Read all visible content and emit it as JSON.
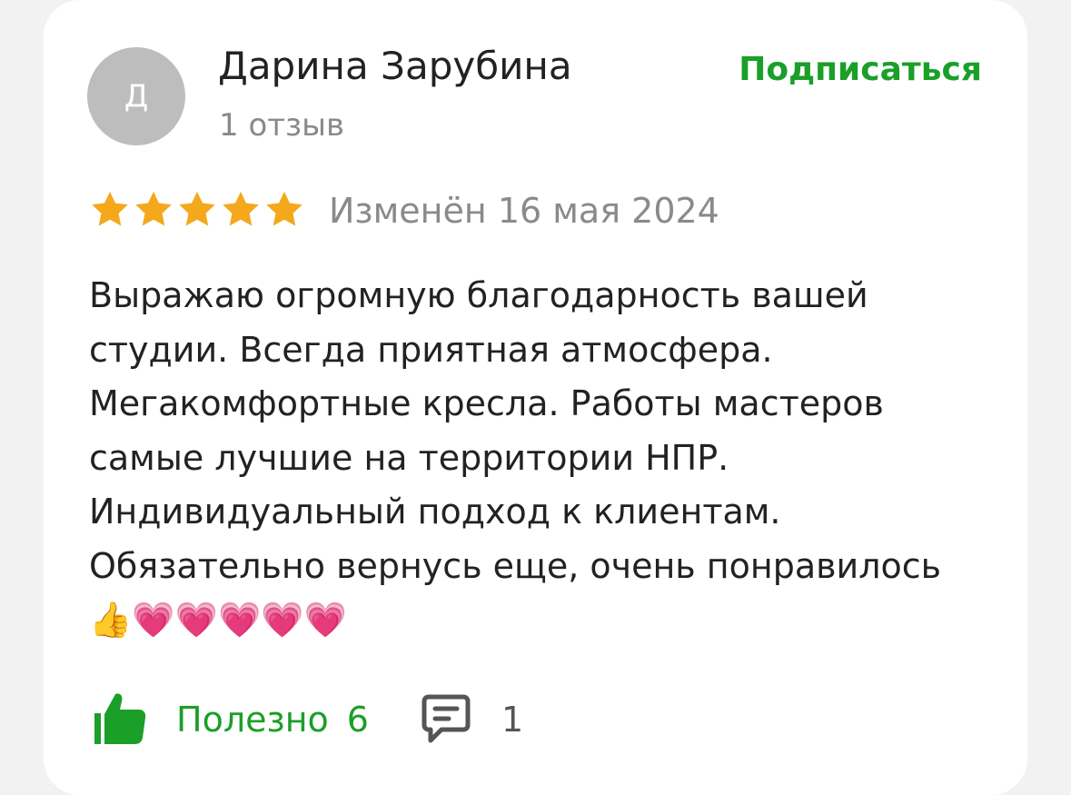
{
  "author": {
    "avatar_letter": "Д",
    "name": "Дарина Зарубина",
    "review_count": "1 отзыв"
  },
  "subscribe_label": "Подписаться",
  "rating": {
    "stars": 5,
    "max": 5,
    "color": "#f4a81c"
  },
  "date": "Изменён 16 мая 2024",
  "review_text": "Выражаю огромную благодарность вашей студии. Всегда приятная атмосфера. Мегакомфортные кресла. Работы мастеров самые лучшие на территории НПР. Индивидуальный подход к клиентам. Обязательно вернусь еще, очень понравилось 👍💗💗💗💗💗",
  "actions": {
    "useful_label": "Полезно",
    "useful_count": "6",
    "comment_count": "1"
  },
  "colors": {
    "accent_green": "#1a9f29",
    "avatar_bg": "#bdbdbd"
  },
  "icons": {
    "useful": "thumbs-up-icon",
    "comments": "comment-icon"
  }
}
